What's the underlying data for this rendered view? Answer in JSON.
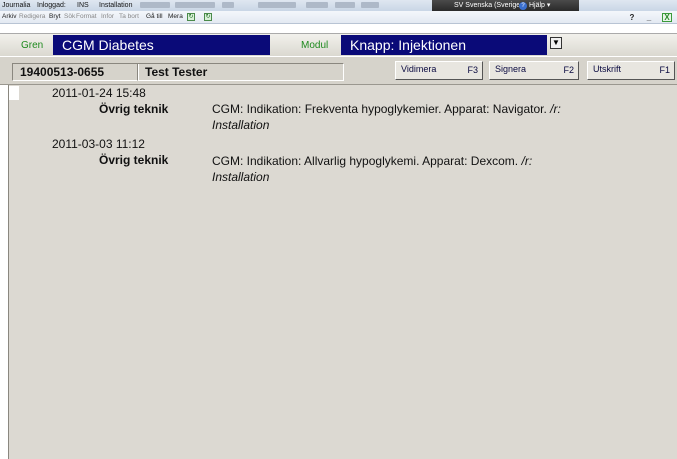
{
  "titlebar": {
    "items": [
      "Journalia",
      "Inloggad:",
      "INS",
      "Installation"
    ],
    "language": "SV Svenska (Sverige)",
    "help": "Hjälp"
  },
  "menubar": {
    "items": [
      "Arkiv",
      "Redigera",
      "Bryt",
      "Sök",
      "Format",
      "Infor",
      "Ta bort",
      "Gå till",
      "Mera"
    ],
    "help_button": "?",
    "minimize_button": "_",
    "close_button": "X"
  },
  "gren": {
    "label": "Gren",
    "value": "CGM Diabetes"
  },
  "modul": {
    "label": "Modul",
    "value": "Knapp: Injektionen"
  },
  "patient": {
    "id": "19400513-0655",
    "name": "Test Tester"
  },
  "function_buttons": [
    {
      "label": "Vidimera",
      "key": "F3"
    },
    {
      "label": "Signera",
      "key": "F2"
    },
    {
      "label": "Utskrift",
      "key": "F1"
    }
  ],
  "entries": [
    {
      "datetime": "2011-01-24 15:48",
      "category": "Övrig teknik",
      "text": "CGM: Indikation: Frekventa hypoglykemier. Apparat: Navigator.",
      "suffix": "/r:",
      "note": "Installation"
    },
    {
      "datetime": "2011-03-03 11:12",
      "category": "Övrig teknik",
      "text": "CGM: Indikation: Allvarlig hypoglykemi. Apparat: Dexcom.",
      "suffix": "/r:",
      "note": "Installation"
    }
  ]
}
